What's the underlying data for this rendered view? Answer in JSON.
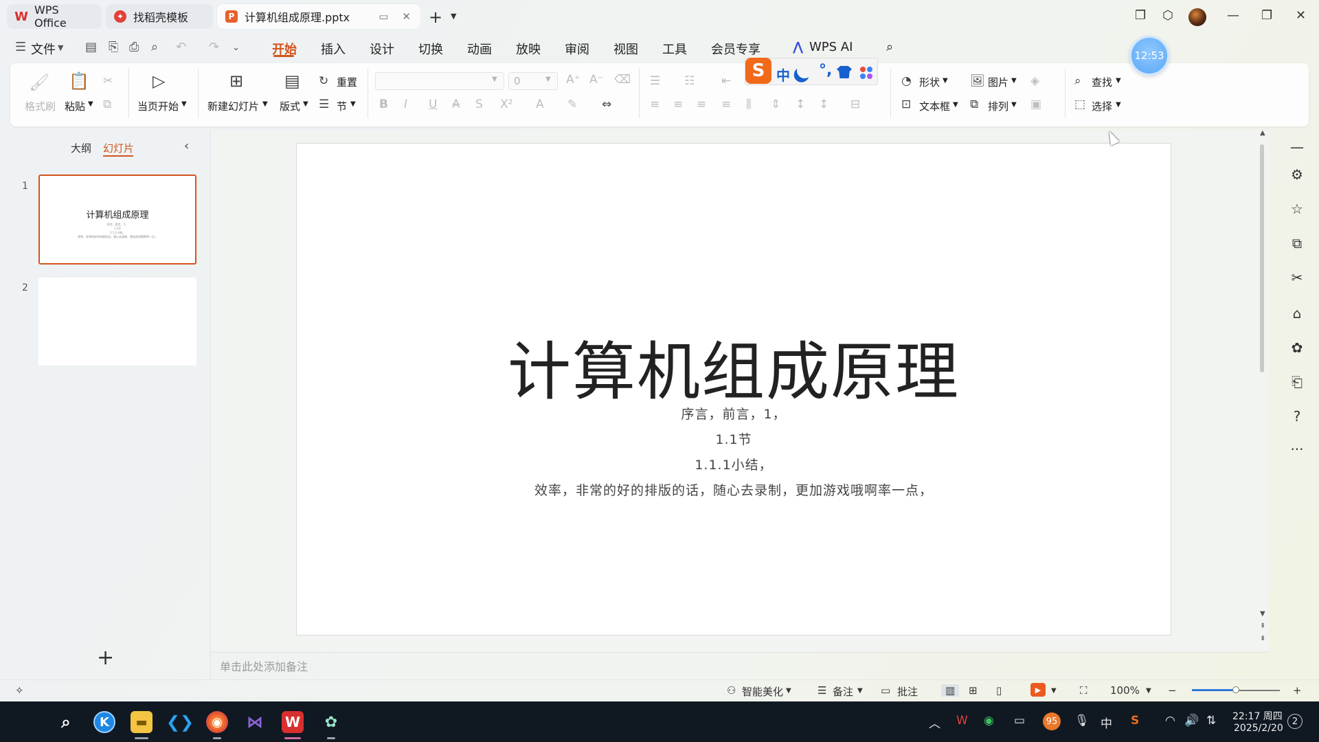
{
  "tabs": [
    {
      "label": "WPS Office"
    },
    {
      "label": "找稻壳模板"
    },
    {
      "label": "计算机组成原理.pptx"
    }
  ],
  "menu": {
    "file_label": "文件",
    "items": [
      "开始",
      "插入",
      "设计",
      "切换",
      "动画",
      "放映",
      "审阅",
      "视图",
      "工具",
      "会员专享"
    ],
    "active": "开始",
    "ai_label": "WPS AI"
  },
  "ribbon": {
    "format_painter": "格式刷",
    "paste": "粘贴",
    "from_current": "当页开始",
    "new_slide": "新建幻灯片",
    "layout": "版式",
    "reset": "重置",
    "section": "节",
    "font_size": "0",
    "shape": "形状",
    "picture": "图片",
    "textbox": "文本框",
    "arrange": "排列",
    "find": "查找",
    "select": "选择"
  },
  "ime": {
    "zh": "中"
  },
  "clock_bubble": "12:53",
  "panel": {
    "outline_tab": "大纲",
    "slides_tab": "幻灯片",
    "slides": [
      {
        "number": "1",
        "title": "计算机组成原理"
      },
      {
        "number": "2",
        "title": ""
      }
    ]
  },
  "slide": {
    "title": "计算机组成原理",
    "lines": [
      "序言，前言，1，",
      "1.1节",
      "1.1.1小结，",
      "效率，非常的好的排版的话，随心去录制，更加游戏哦啊率一点，"
    ]
  },
  "notes_placeholder": "单击此处添加备注",
  "status": {
    "beautify": "智能美化",
    "notes": "备注",
    "comments": "批注",
    "zoom": "100%",
    "zoom_fraction": 0.5
  },
  "taskbar": {
    "time": "22:17 周四",
    "date": "2025/2/20",
    "notification_count": "2",
    "tray_badge": "95",
    "ime_lang": "中"
  },
  "colors": {
    "accent": "#d3541d",
    "taskbar": "#101922"
  }
}
